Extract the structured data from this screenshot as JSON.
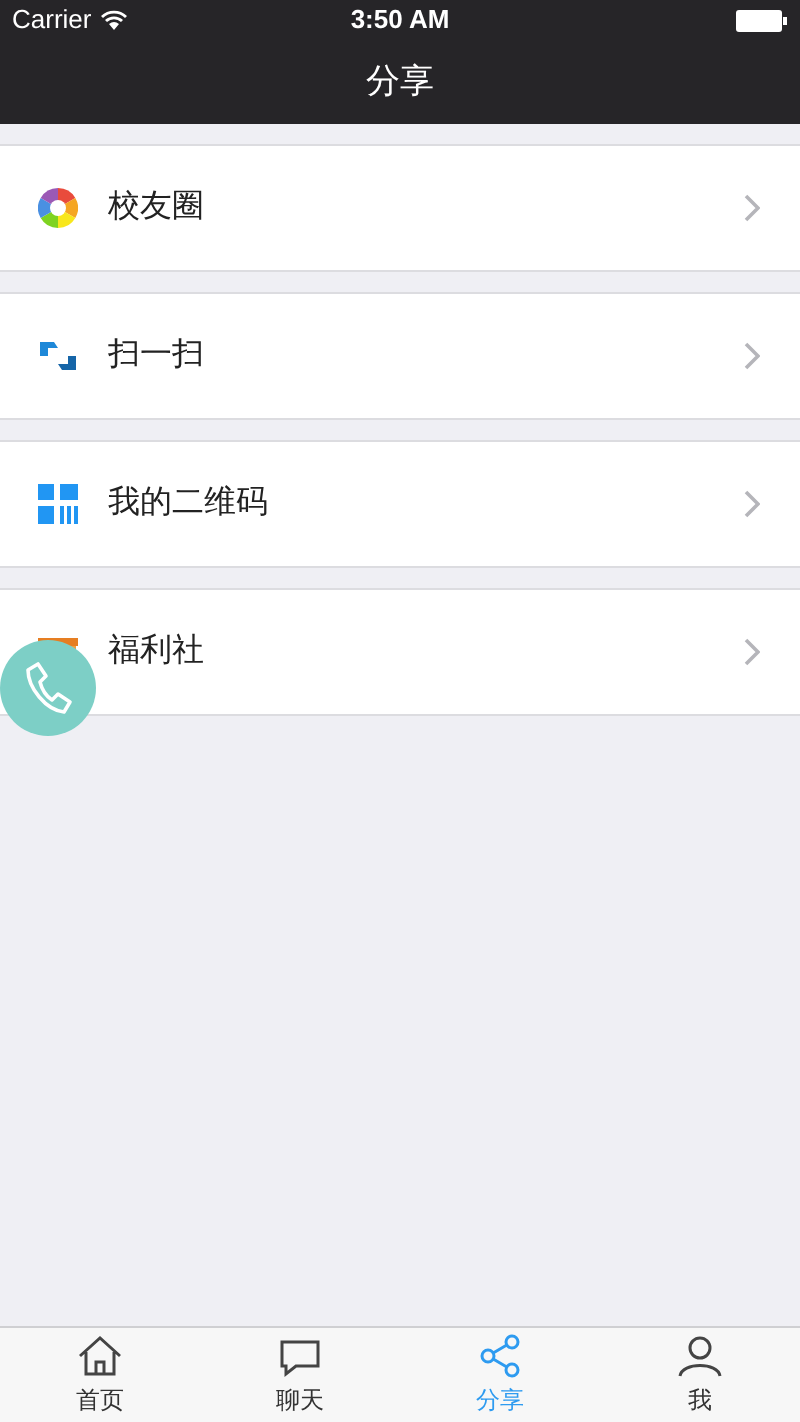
{
  "status_bar": {
    "carrier": "Carrier",
    "time": "3:50 AM"
  },
  "nav_bar": {
    "title": "分享"
  },
  "menu_items": [
    {
      "label": "校友圈",
      "kind": "circle"
    },
    {
      "label": "扫一扫",
      "kind": "scan"
    },
    {
      "label": "我的二维码",
      "kind": "qr"
    },
    {
      "label": "福利社",
      "kind": "gift"
    }
  ],
  "tab_bar": [
    {
      "label": "首页",
      "kind": "home",
      "selected": false
    },
    {
      "label": "聊天",
      "kind": "chat",
      "selected": false
    },
    {
      "label": "分享",
      "kind": "share",
      "selected": true
    },
    {
      "label": "我",
      "kind": "me",
      "selected": false
    }
  ]
}
